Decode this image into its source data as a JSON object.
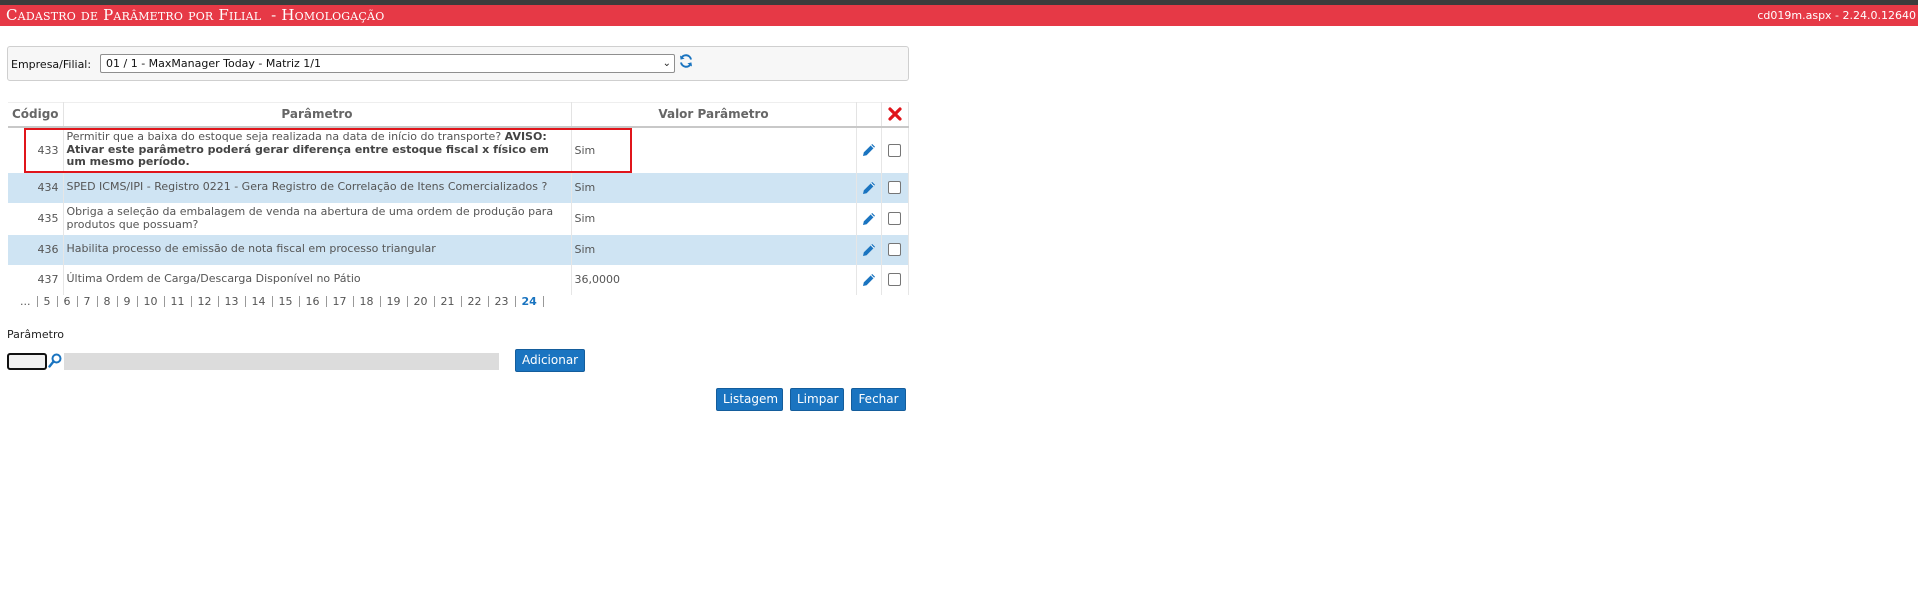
{
  "window": {
    "title": "Cadastro de Parâmetro por Filial  - Homologação",
    "version": "cd019m.aspx - 2.24.0.12640"
  },
  "filter": {
    "label": "Empresa/Filial:",
    "selected": "01 / 1 - MaxManager Today - Matriz 1/1"
  },
  "grid": {
    "headers": {
      "code": "Código",
      "param": "Parâmetro",
      "value": "Valor Parâmetro"
    },
    "rows": [
      {
        "code": "433",
        "param": "Permitir que a baixa do estoque seja realizada na data de início do transporte?",
        "param_bold": "AVISO: Ativar este parâmetro poderá gerar diferença entre estoque fiscal x físico em um mesmo período.",
        "value": "Sim"
      },
      {
        "code": "434",
        "param": "SPED ICMS/IPI - Registro 0221 - Gera Registro de Correlação de Itens Comercializados ?",
        "value": "Sim"
      },
      {
        "code": "435",
        "param": "Obriga a seleção da embalagem de venda na abertura de uma ordem de produção para produtos que possuam?",
        "value": "Sim"
      },
      {
        "code": "436",
        "param": "Habilita processo de emissão de nota fiscal em processo triangular",
        "value": "Sim"
      },
      {
        "code": "437",
        "param": "Última Ordem de Carga/Descarga Disponível no Pátio",
        "value": "36,0000"
      }
    ]
  },
  "pager": {
    "ellipsis": "...",
    "pages": [
      "5",
      "6",
      "7",
      "8",
      "9",
      "10",
      "11",
      "12",
      "13",
      "14",
      "15",
      "16",
      "17",
      "18",
      "19",
      "20",
      "21",
      "22",
      "23",
      "24"
    ],
    "current": "24"
  },
  "form": {
    "param_label": "Parâmetro",
    "add_button": "Adicionar"
  },
  "footer": {
    "list_button": "Listagem",
    "clear_button": "Limpar",
    "close_button": "Fechar"
  },
  "colors": {
    "title_bar": "#e63946",
    "accent": "#1a74c0",
    "alt_row": "#cfe4f3",
    "highlight_border": "#e0151b"
  }
}
